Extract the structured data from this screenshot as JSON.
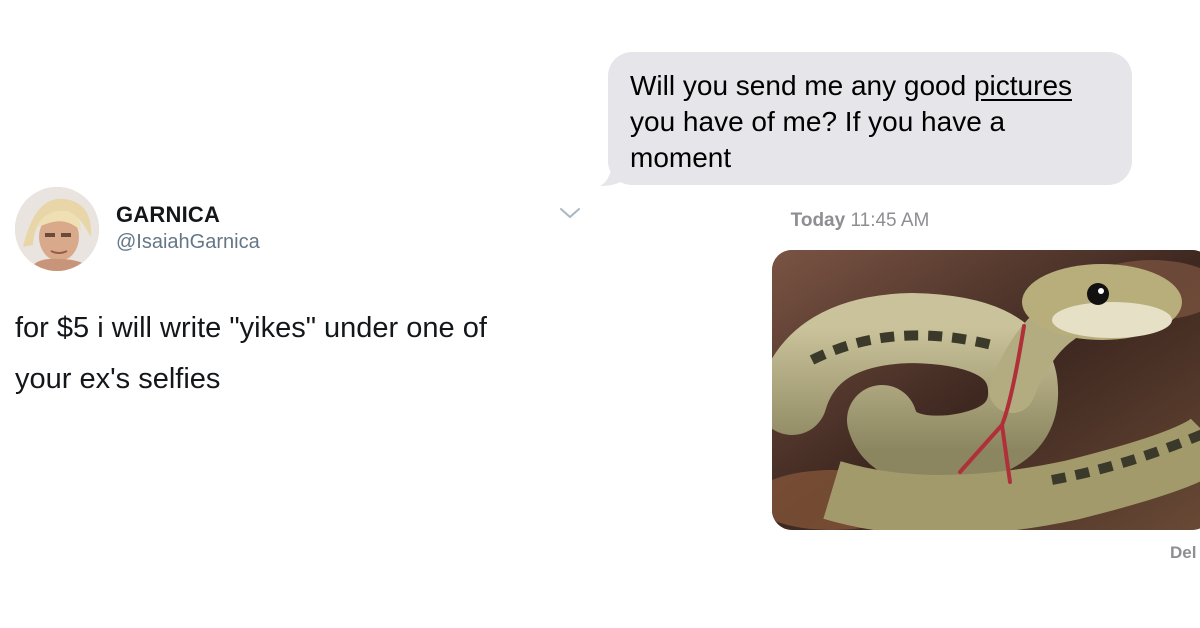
{
  "tweet": {
    "display_name": "GARNICA",
    "handle": "@IsaiahGarnica",
    "text_line1": "for $5 i will write \"yikes\" under one of",
    "text_line2": "your ex's selfies",
    "avatar_icon": "user-avatar",
    "menu_icon": "chevron-down-icon"
  },
  "messages": {
    "bubble": {
      "line1_pre": "Will you send me any good ",
      "line1_link": "pictures",
      "line2": "you have of me? If you have a",
      "line3": "moment",
      "color": "#e5e5ea"
    },
    "timestamp_day": "Today",
    "timestamp_time": "11:45 AM",
    "image_subject": "snake-photo",
    "status_fragment": "Del"
  }
}
